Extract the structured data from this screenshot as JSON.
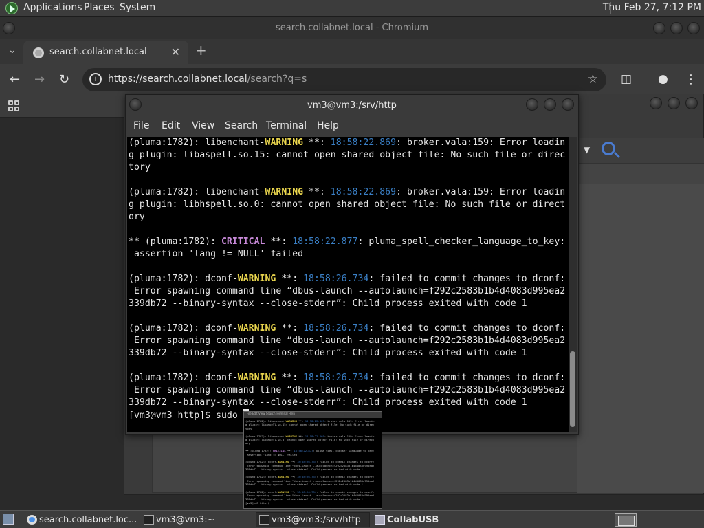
{
  "top_panel": {
    "menus": [
      "Applications",
      "Places",
      "System"
    ],
    "clock": "Thu Feb 27,  7:12 PM"
  },
  "browser": {
    "window_title": "search.collabnet.local - Chromium",
    "tab_title": "search.collabnet.local",
    "new_tab_symbol": "+",
    "url_host": "https://search.collabnet.local",
    "url_path": "/search?q=s",
    "icons": [
      "back-icon",
      "forward-icon",
      "reload-icon",
      "site-info-icon",
      "bookmark-star-icon",
      "extensions-icon",
      "profile-icon",
      "menu-icon",
      "apps-icon"
    ]
  },
  "terminal": {
    "title": "vm3@vm3:/srv/http",
    "menu": [
      "File",
      "Edit",
      "View",
      "Search",
      "Terminal",
      "Help"
    ],
    "prompt": "[vm3@vm3 http]$ sudo "
  },
  "taskbar": {
    "items": [
      "search.collabnet.loc...",
      "vm3@vm3:~",
      "vm3@vm3:/srv/http",
      "CollabUSB"
    ],
    "active_item": "vm3@vm3:/srv/http"
  },
  "colors": {
    "warning": "#e8d44d",
    "critical": "#c88ad9",
    "timestamp": "#3a7fc5",
    "terminal_bg": "#000000"
  }
}
